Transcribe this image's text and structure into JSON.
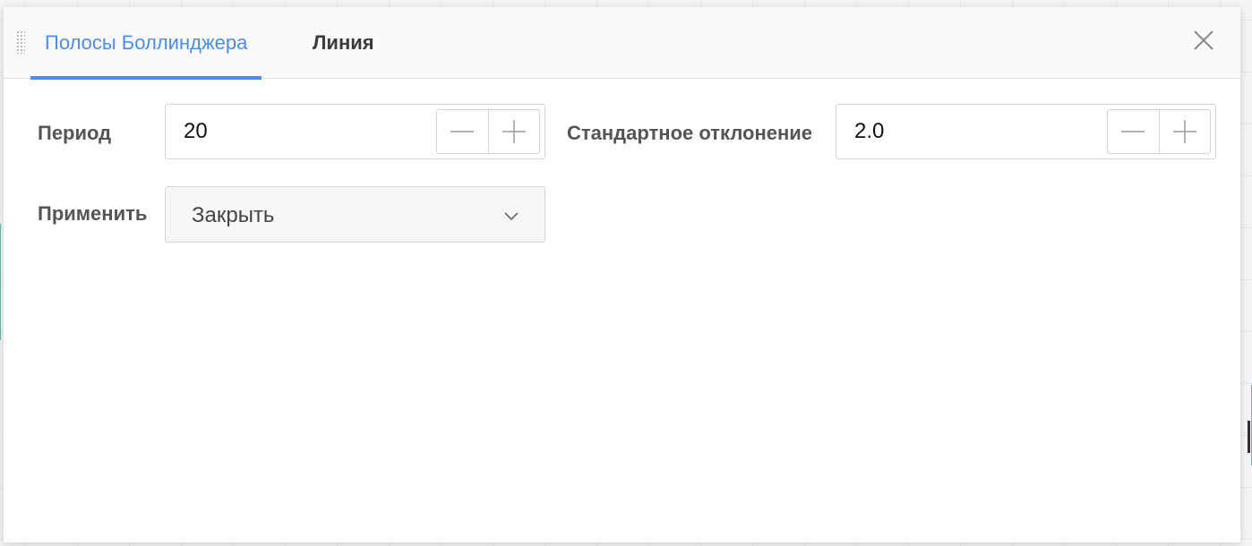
{
  "tabs": [
    {
      "label": "Полосы Боллинджера",
      "active": true
    },
    {
      "label": "Линия",
      "active": false
    }
  ],
  "fields": {
    "period": {
      "label": "Период",
      "value": "20"
    },
    "std_dev": {
      "label": "Стандартное отклонение",
      "value": "2.0"
    },
    "apply": {
      "label": "Применить",
      "value": "Закрыть"
    }
  },
  "colors": {
    "accent": "#4a8cf0",
    "label": "#555555",
    "border": "#d4d4d4"
  },
  "icons": {
    "drag": "drag-handle-icon",
    "close": "close-icon",
    "minus": "minus-icon",
    "plus": "plus-icon",
    "chevron": "chevron-down-icon"
  }
}
